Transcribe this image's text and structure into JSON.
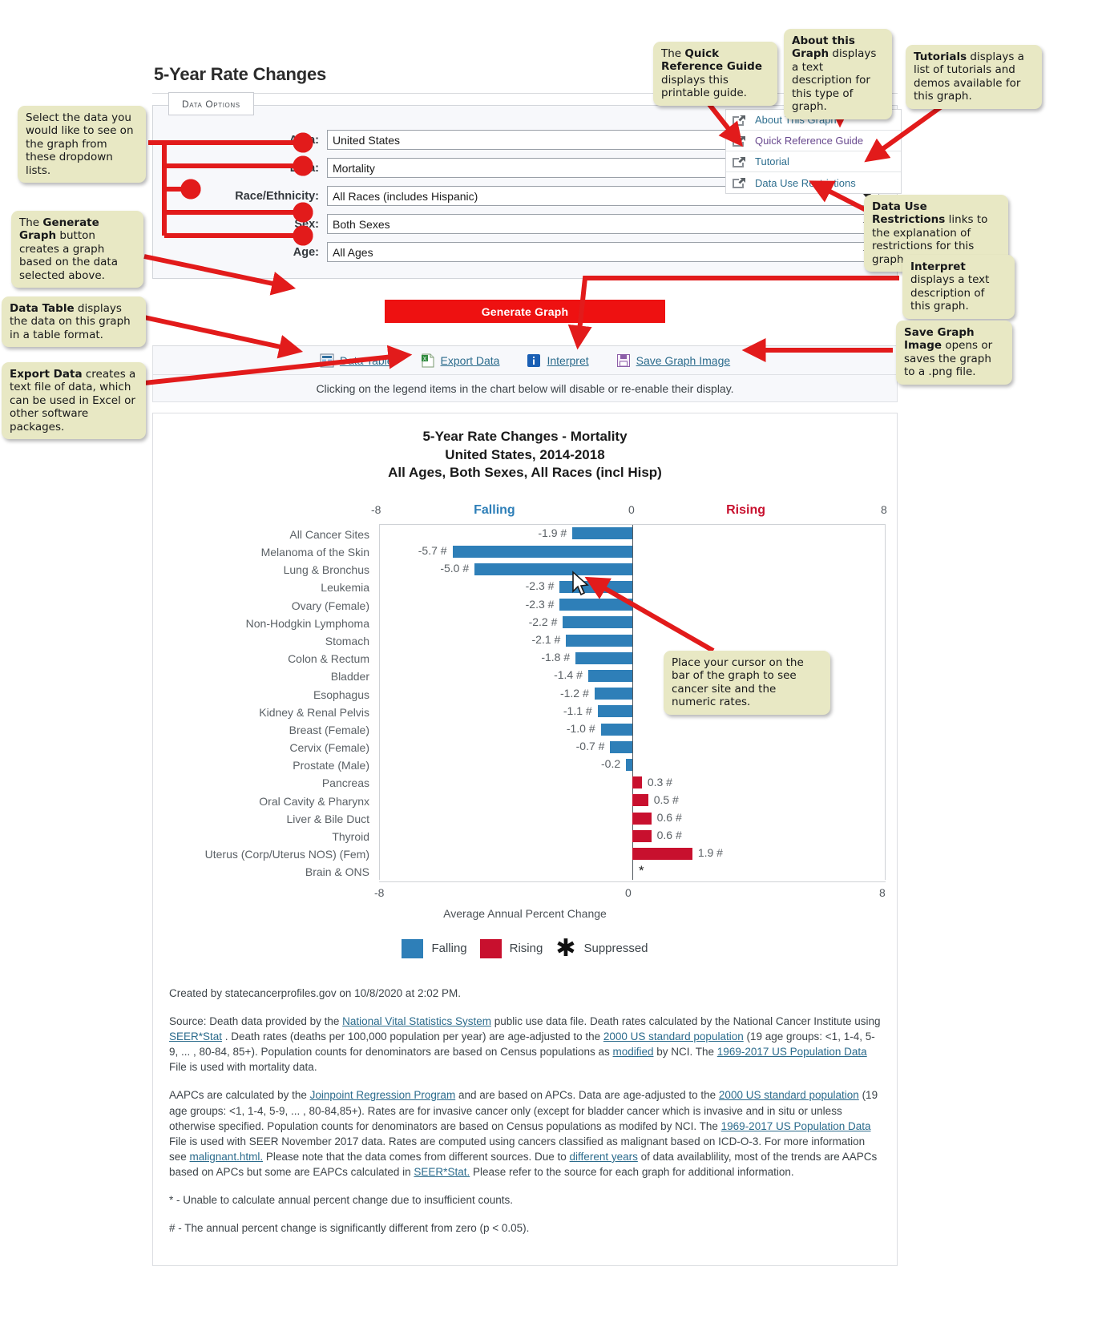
{
  "page": {
    "title": "5-Year Rate Changes"
  },
  "data_options": {
    "tab_label_first": "D",
    "tab_label_rest": "ATA ",
    "tab_label": "Data Options",
    "rows": [
      {
        "label": "Area:",
        "value": "United States"
      },
      {
        "label": "Data:",
        "value": "Mortality"
      },
      {
        "label": "Race/Ethnicity:",
        "value": "All Races (includes Hispanic)"
      },
      {
        "label": "Sex:",
        "value": "Both Sexes"
      },
      {
        "label": "Age:",
        "value": "All Ages"
      }
    ]
  },
  "link_list": [
    {
      "label": "About This Graph"
    },
    {
      "label": "Quick Reference Guide"
    },
    {
      "label": "Tutorial"
    },
    {
      "label": "Data Use Restrictions"
    }
  ],
  "generate_button": {
    "label": "Generate Graph"
  },
  "toolbar": {
    "items": [
      {
        "label": "Data Table",
        "icon": "table-icon"
      },
      {
        "label": "Export Data",
        "icon": "excel-icon"
      },
      {
        "label": "Interpret",
        "icon": "info-icon"
      },
      {
        "label": "Save Graph Image",
        "icon": "floppy-disk-icon"
      }
    ]
  },
  "legend_note": "Clicking on the legend items in the chart below will disable or re-enable their display.",
  "chart_data": {
    "type": "bar",
    "orientation": "horizontal",
    "title_lines": [
      "5-Year Rate Changes - Mortality",
      "United States, 2014-2018",
      "All Ages, Both Sexes, All Races (incl Hisp)"
    ],
    "xlabel": "Average Annual Percent Change",
    "xlim": [
      -8,
      8
    ],
    "xticks": [
      -8,
      0,
      8
    ],
    "xtick_labels": [
      "-8",
      "0",
      "8"
    ],
    "direction_labels": {
      "negative": "Falling",
      "positive": "Rising"
    },
    "grid": false,
    "legend_position": "bottom",
    "colors": {
      "falling": "#2e7fb8",
      "rising": "#c8102e",
      "axis": "#555b61"
    },
    "legend": [
      {
        "label": "Falling",
        "color": "#2e7fb8",
        "marker": "square"
      },
      {
        "label": "Rising",
        "color": "#c8102e",
        "marker": "square"
      },
      {
        "label": "Suppressed",
        "color": "#111111",
        "marker": "asterisk"
      }
    ],
    "categories": [
      "All Cancer Sites",
      "Melanoma of the Skin",
      "Lung & Bronchus",
      "Leukemia",
      "Ovary (Female)",
      "Non-Hodgkin Lymphoma",
      "Stomach",
      "Colon & Rectum",
      "Bladder",
      "Esophagus",
      "Kidney & Renal Pelvis",
      "Breast (Female)",
      "Cervix (Female)",
      "Prostate (Male)",
      "Pancreas",
      "Oral Cavity & Pharynx",
      "Liver & Bile Duct",
      "Thyroid",
      "Uterus (Corp/Uterus NOS) (Fem)",
      "Brain & ONS"
    ],
    "values": [
      -1.9,
      -5.7,
      -5.0,
      -2.3,
      -2.3,
      -2.2,
      -2.1,
      -1.8,
      -1.4,
      -1.2,
      -1.1,
      -1.0,
      -0.7,
      -0.2,
      0.3,
      0.5,
      0.6,
      0.6,
      1.9,
      null
    ],
    "value_labels": [
      "-1.9 #",
      "-5.7 #",
      "-5.0 #",
      "-2.3 #",
      "-2.3 #",
      "-2.2 #",
      "-2.1 #",
      "-1.8 #",
      "-1.4 #",
      "-1.2 #",
      "-1.1 #",
      "-1.0 #",
      "-0.7 #",
      "-0.2",
      "0.3 #",
      "0.5 #",
      "0.6 #",
      "0.6 #",
      "1.9 #",
      "*"
    ],
    "suppressed": [
      false,
      false,
      false,
      false,
      false,
      false,
      false,
      false,
      false,
      false,
      false,
      false,
      false,
      false,
      false,
      false,
      false,
      false,
      false,
      true
    ]
  },
  "notes": {
    "created": "Created by statecancerprofiles.gov on 10/8/2020 at 2:02 PM.",
    "source_parts": [
      "Source: Death data provided by the ",
      "National Vital Statistics System",
      " public use data file. Death rates calculated by the National Cancer Institute using ",
      "SEER*Stat",
      " . Death rates (deaths per 100,000 population per year) are age-adjusted to the ",
      "2000 US standard population",
      " (19 age groups: <1, 1-4, 5-9, ... , 80-84, 85+). Population counts for denominators are based on Census populations as ",
      "modified",
      " by NCI. The ",
      "1969-2017 US Population Data",
      " File is used with mortality data."
    ],
    "aapc_parts": [
      "AAPCs are calculated by the ",
      "Joinpoint Regression Program",
      " and are based on APCs. Data are age-adjusted to the ",
      "2000 US standard population",
      " (19 age groups: <1, 1-4, 5-9, ... , 80-84,85+). Rates are for invasive cancer only (except for bladder cancer which is invasive and in situ or unless otherwise specified. Population counts for denominators are based on Census populations as modifed by NCI. The ",
      "1969-2017 US Population Data",
      " File is used with SEER November 2017 data. Rates are computed using cancers classified as malignant based on ICD-O-3. For more information see ",
      "malignant.html.",
      " Please note that the data comes from different sources. Due to ",
      "different years",
      " of data availablility, most of the trends are AAPCs based on APCs but some are EAPCs calculated in ",
      "SEER*Stat.",
      " Please refer to the source for each graph for additional information."
    ],
    "footnote_star": "* - Unable to calculate annual percent change due to insufficient counts.",
    "footnote_hash": "# - The annual percent change is significantly different from zero (p < 0.05)."
  },
  "callouts": [
    {
      "id": "dropdowns",
      "html": "Select the data you would like to see on the graph from these dropdown lists."
    },
    {
      "id": "generate",
      "html": "The <b>Generate Graph</b> button creates a graph based on the data selected above."
    },
    {
      "id": "datatable",
      "html": "<b>Data Table</b> displays the data on this graph in a table format."
    },
    {
      "id": "exportdata",
      "html": "<b>Export Data</b> creates a text file of data, which can be used in Excel or other software packages."
    },
    {
      "id": "quickref",
      "html": "The <b>Quick Reference Guide</b> displays this printable guide."
    },
    {
      "id": "about",
      "html": "<b>About this Graph</b> displays a text description for this type of graph."
    },
    {
      "id": "tutorials",
      "html": "<b>Tutorials</b> displays a list of tutorials and demos available for this graph."
    },
    {
      "id": "datause",
      "html": "<b>Data Use Restrictions</b> links to the explanation of restrictions for this graph."
    },
    {
      "id": "interpret",
      "html": "<b>Interpret</b> displays a text description of this graph."
    },
    {
      "id": "savegraph",
      "html": "<b>Save Graph Image</b> opens or saves the graph to a .png file."
    },
    {
      "id": "cursor",
      "html": "Place your cursor on the bar of the graph to see cancer site and the numeric rates."
    }
  ]
}
